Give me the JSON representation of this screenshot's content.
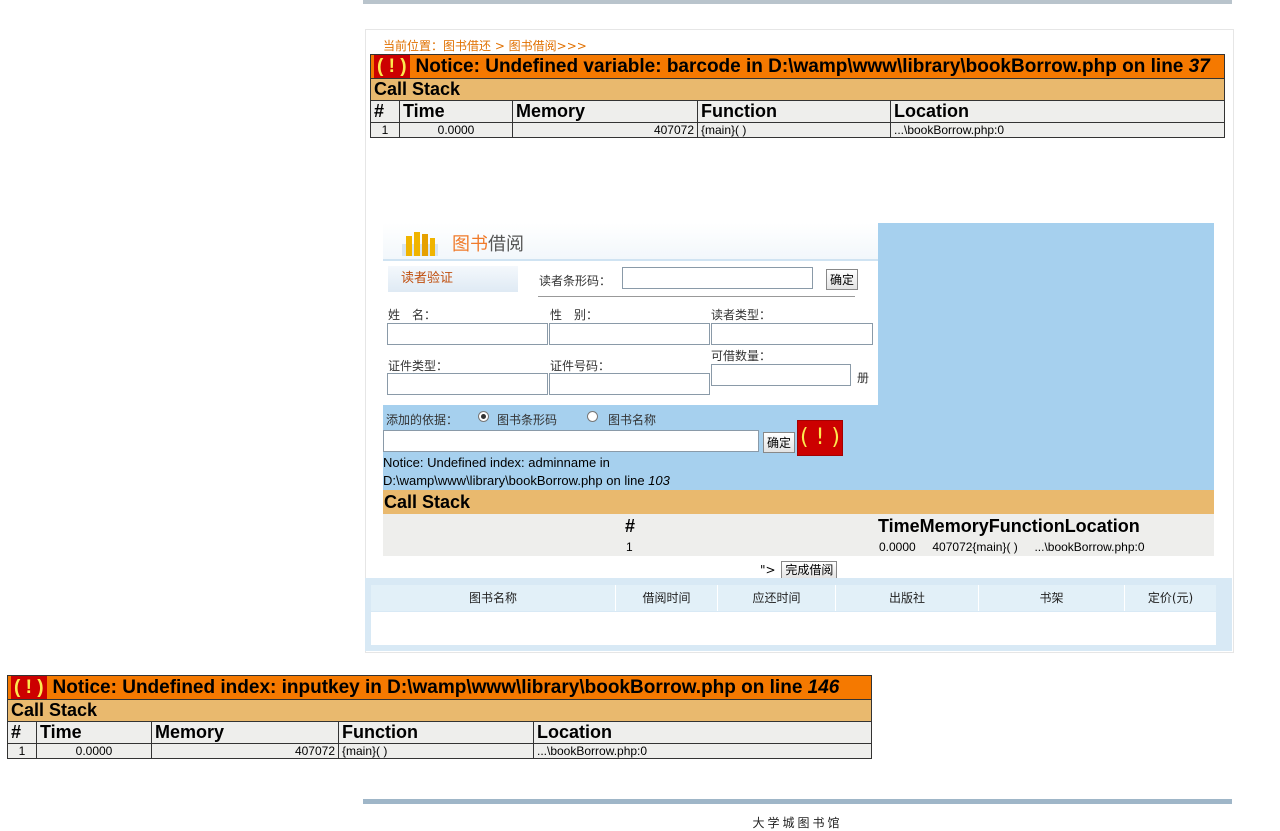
{
  "breadcrumb": "当前位置：图书借还 > 图书借阅>>>",
  "error1": {
    "bang": "( ! )",
    "message": "Notice: Undefined variable: barcode in D:\\wamp\\www\\library\\bookBorrow.php on line ",
    "line": "37",
    "call_stack": "Call Stack",
    "headers": [
      "#",
      "Time",
      "Memory",
      "Function",
      "Location"
    ],
    "row": {
      "n": "1",
      "time": "0.0000",
      "memory": "407072",
      "function": "{main}( )",
      "location": "...\\bookBorrow.php:0"
    }
  },
  "card": {
    "title_part1": "图书",
    "title_part2": "借阅",
    "verify_tab": "读者验证",
    "barcode_label": "读者条形码：",
    "confirm": "确定",
    "name_label": "姓　名：",
    "gender_label": "性　别：",
    "reader_type_label": "读者类型：",
    "id_type_label": "证件类型：",
    "id_number_label": "证件号码：",
    "borrow_count_label": "可借数量：",
    "unit": "册"
  },
  "add_basis": {
    "label": "添加的依据：",
    "option1": "图书条形码",
    "option2": "图书名称",
    "confirm": "确定"
  },
  "error2": {
    "bang": "( ! )",
    "message_line1": "Notice: Undefined index: adminname in",
    "message_line2": "D:\\wamp\\www\\library\\bookBorrow.php on line ",
    "line": "103",
    "call_stack": "Call Stack",
    "col_num": "#",
    "headers_joined": "TimeMemoryFunctionLocation",
    "row_n": "1",
    "row_rest": "0.0000     407072{main}( )     ...\\bookBorrow.php:0"
  },
  "finish": {
    "prefix": "\">",
    "button": "完成借阅"
  },
  "table": {
    "headers": [
      "图书名称",
      "借阅时间",
      "应还时间",
      "出版社",
      "书架",
      "定价(元)"
    ]
  },
  "error3": {
    "bang": "( ! )",
    "message": "Notice: Undefined index: inputkey in D:\\wamp\\www\\library\\bookBorrow.php on line ",
    "line": "146",
    "call_stack": "Call Stack",
    "headers": [
      "#",
      "Time",
      "Memory",
      "Function",
      "Location"
    ],
    "row": {
      "n": "1",
      "time": "0.0000",
      "memory": "407072",
      "function": "{main}( )",
      "location": "...\\bookBorrow.php:0"
    }
  },
  "footer": "大学城图书馆"
}
